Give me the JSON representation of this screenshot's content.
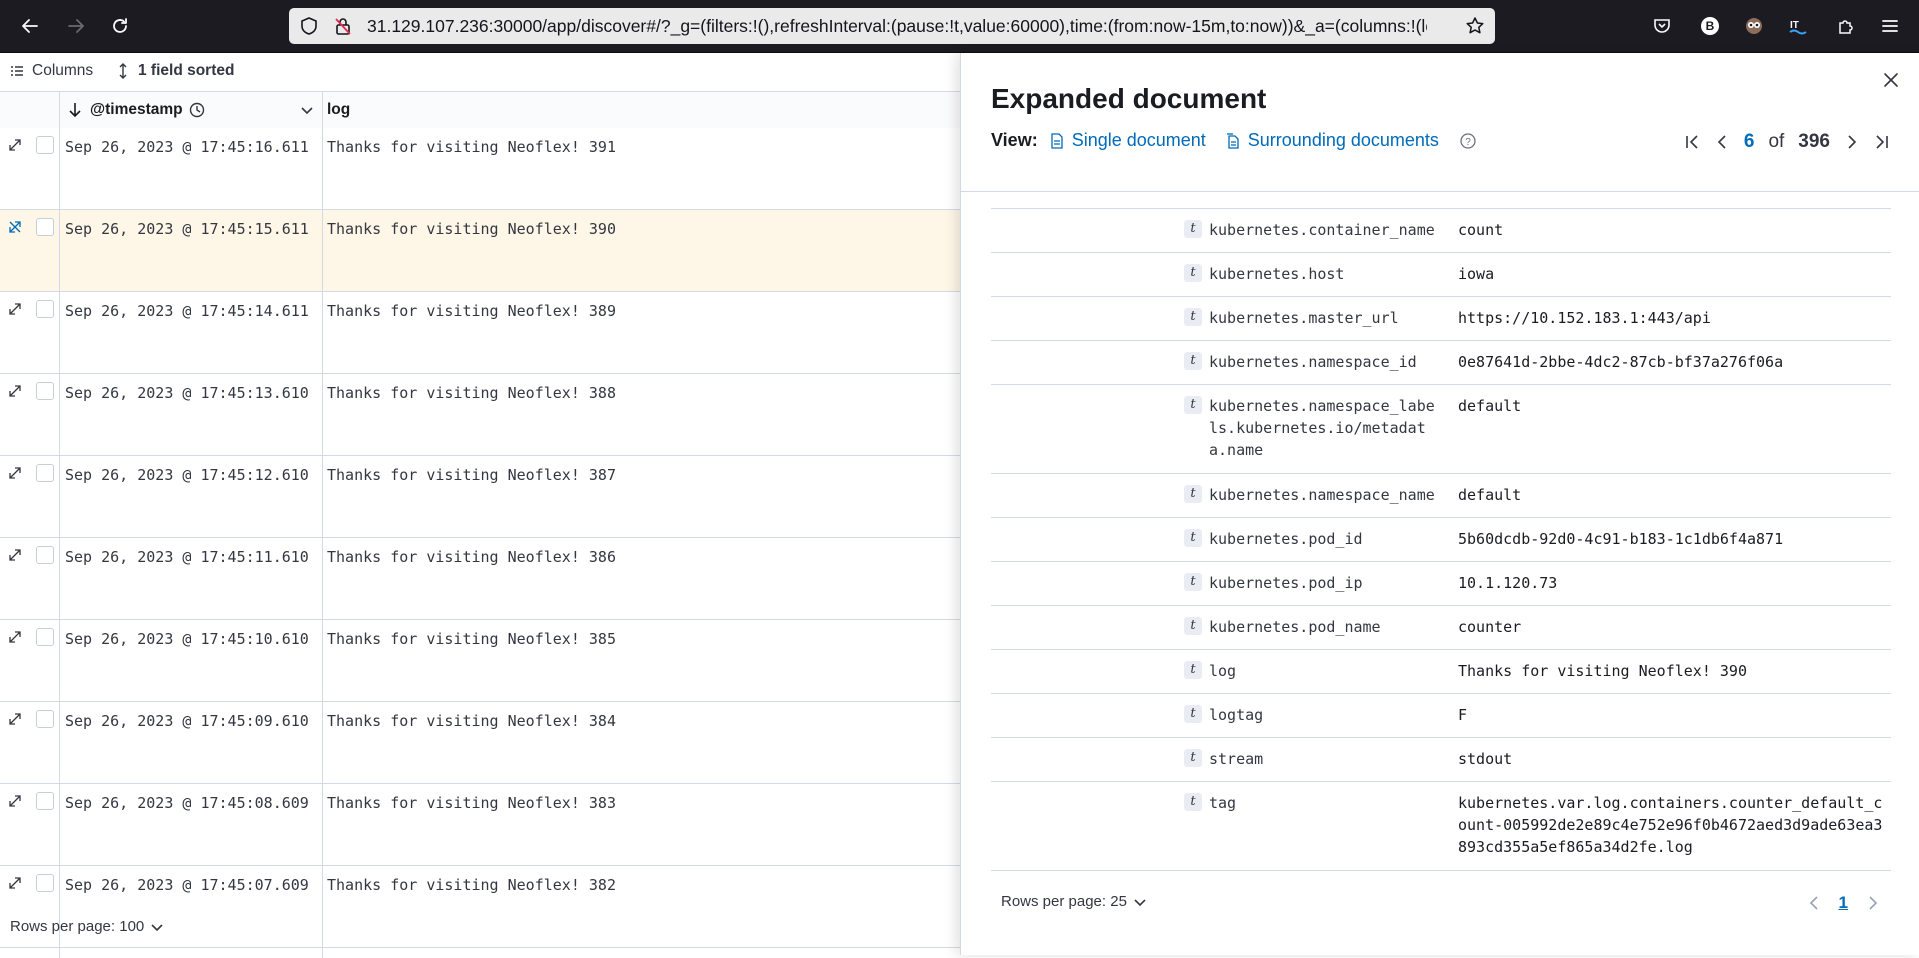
{
  "browser": {
    "url": "31.129.107.236:30000/app/discover#/?_g=(filters:!(),refreshInterval:(pause:!t,value:60000),time:(from:now-15m,to:now))&_a=(columns:!(log),filters:!(),index:'logs',interval:auto,query:(language:kuery,query:''),sort:!(!('@timestamp',desc)))",
    "profile_initial": "B"
  },
  "toolbar": {
    "columns_label": "Columns",
    "sort_label": "1 field sorted"
  },
  "grid": {
    "col_timestamp": "@timestamp",
    "col_log": "log",
    "rows": [
      {
        "ts": "Sep 26, 2023 @ 17:45:16.611",
        "log": "Thanks for visiting Neoflex! 391"
      },
      {
        "ts": "Sep 26, 2023 @ 17:45:15.611",
        "log": "Thanks for visiting Neoflex! 390"
      },
      {
        "ts": "Sep 26, 2023 @ 17:45:14.611",
        "log": "Thanks for visiting Neoflex! 389"
      },
      {
        "ts": "Sep 26, 2023 @ 17:45:13.610",
        "log": "Thanks for visiting Neoflex! 388"
      },
      {
        "ts": "Sep 26, 2023 @ 17:45:12.610",
        "log": "Thanks for visiting Neoflex! 387"
      },
      {
        "ts": "Sep 26, 2023 @ 17:45:11.610",
        "log": "Thanks for visiting Neoflex! 386"
      },
      {
        "ts": "Sep 26, 2023 @ 17:45:10.610",
        "log": "Thanks for visiting Neoflex! 385"
      },
      {
        "ts": "Sep 26, 2023 @ 17:45:09.610",
        "log": "Thanks for visiting Neoflex! 384"
      },
      {
        "ts": "Sep 26, 2023 @ 17:45:08.609",
        "log": "Thanks for visiting Neoflex! 383"
      },
      {
        "ts": "Sep 26, 2023 @ 17:45:07.609",
        "log": "Thanks for visiting Neoflex! 382"
      }
    ],
    "rows_per_page": "Rows per page: 100"
  },
  "flyout": {
    "title": "Expanded document",
    "view_label": "View:",
    "single_document": "Single document",
    "surrounding_documents": "Surrounding documents",
    "current": "6",
    "of": "of",
    "total": "396",
    "fields": [
      {
        "type": "t",
        "name": "kubernetes.container_name",
        "value": "count"
      },
      {
        "type": "t",
        "name": "kubernetes.host",
        "value": "iowa"
      },
      {
        "type": "t",
        "name": "kubernetes.master_url",
        "value": "https://10.152.183.1:443/api"
      },
      {
        "type": "t",
        "name": "kubernetes.namespace_id",
        "value": "0e87641d-2bbe-4dc2-87cb-bf37a276f06a"
      },
      {
        "type": "t",
        "name": "kubernetes.namespace_labels.kubernetes.io/metadata.name",
        "value": "default"
      },
      {
        "type": "t",
        "name": "kubernetes.namespace_name",
        "value": "default"
      },
      {
        "type": "t",
        "name": "kubernetes.pod_id",
        "value": "5b60dcdb-92d0-4c91-b183-1c1db6f4a871"
      },
      {
        "type": "t",
        "name": "kubernetes.pod_ip",
        "value": "10.1.120.73"
      },
      {
        "type": "t",
        "name": "kubernetes.pod_name",
        "value": "counter"
      },
      {
        "type": "t",
        "name": "log",
        "value": "Thanks for visiting Neoflex! 390"
      },
      {
        "type": "t",
        "name": "logtag",
        "value": "F"
      },
      {
        "type": "t",
        "name": "stream",
        "value": "stdout"
      },
      {
        "type": "t",
        "name": "tag",
        "value": "kubernetes.var.log.containers.counter_default_count-005992de2e89c4e752e96f0b4672aed3d9ade63ea3893cd355a5ef865a34d2fe.log"
      }
    ],
    "rows_per_page": "Rows per page: 25",
    "page": "1"
  }
}
